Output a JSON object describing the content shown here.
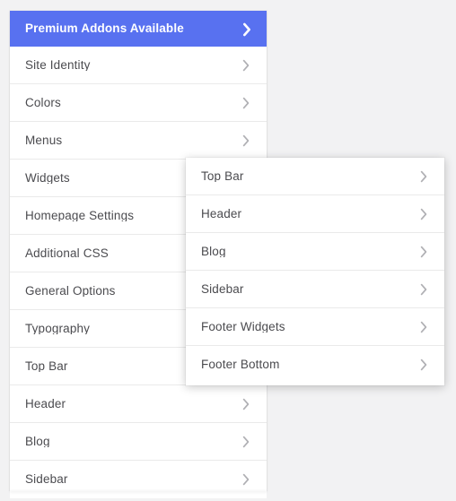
{
  "theme": {
    "accent_color": "#5871f0",
    "page_background": "#f2f2f3",
    "panel_background": "#ffffff",
    "divider_color": "#eaeaea",
    "label_color": "#4b4b4f",
    "chevron_color": "#b0b0b4"
  },
  "primary_panel": {
    "name": "customizer-main-menu",
    "items": [
      {
        "label": "Premium Addons Available",
        "icon": "chevron-right-icon",
        "highlighted": true
      },
      {
        "label": "Site Identity",
        "icon": "chevron-right-icon",
        "highlighted": false
      },
      {
        "label": "Colors",
        "icon": "chevron-right-icon",
        "highlighted": false
      },
      {
        "label": "Menus",
        "icon": "chevron-right-icon",
        "highlighted": false
      },
      {
        "label": "Widgets",
        "icon": "chevron-right-icon",
        "highlighted": false
      },
      {
        "label": "Homepage Settings",
        "icon": "chevron-right-icon",
        "highlighted": false
      },
      {
        "label": "Additional CSS",
        "icon": "chevron-right-icon",
        "highlighted": false
      },
      {
        "label": "General Options",
        "icon": "chevron-right-icon",
        "highlighted": false
      },
      {
        "label": "Typography",
        "icon": "chevron-right-icon",
        "highlighted": false
      },
      {
        "label": "Top Bar",
        "icon": "chevron-right-icon",
        "highlighted": false
      },
      {
        "label": "Header",
        "icon": "chevron-right-icon",
        "highlighted": false
      },
      {
        "label": "Blog",
        "icon": "chevron-right-icon",
        "highlighted": false
      },
      {
        "label": "Sidebar",
        "icon": "chevron-right-icon",
        "highlighted": false
      }
    ]
  },
  "secondary_panel": {
    "name": "customizer-submenu",
    "items": [
      {
        "label": "Top Bar",
        "icon": "chevron-right-icon"
      },
      {
        "label": "Header",
        "icon": "chevron-right-icon"
      },
      {
        "label": "Blog",
        "icon": "chevron-right-icon"
      },
      {
        "label": "Sidebar",
        "icon": "chevron-right-icon"
      },
      {
        "label": "Footer Widgets",
        "icon": "chevron-right-icon"
      },
      {
        "label": "Footer Bottom",
        "icon": "chevron-right-icon"
      }
    ]
  }
}
